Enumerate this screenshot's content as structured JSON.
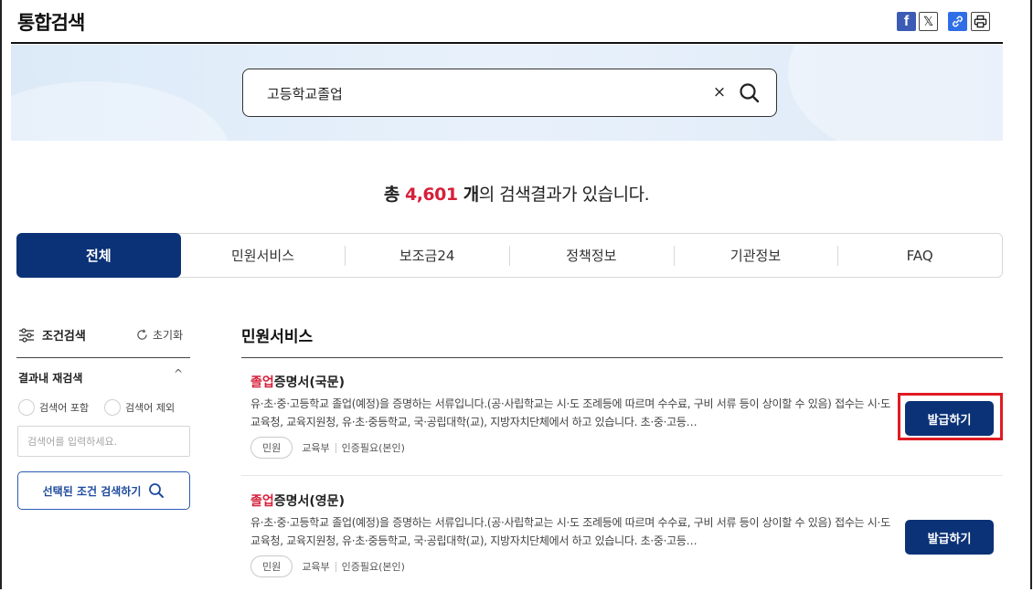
{
  "header": {
    "title": "통합검색",
    "share": {
      "facebook": "f",
      "x": "𝕏"
    }
  },
  "search": {
    "query": "고등학교졸업",
    "clear_icon": "×"
  },
  "summary": {
    "prefix": "총 ",
    "count": "4,601",
    "unit": " 개",
    "suffix": "의 검색결과가 있습니다."
  },
  "tabs": [
    {
      "label": "전체",
      "active": true
    },
    {
      "label": "민원서비스",
      "active": false
    },
    {
      "label": "보조금24",
      "active": false
    },
    {
      "label": "정책정보",
      "active": false
    },
    {
      "label": "기관정보",
      "active": false
    },
    {
      "label": "FAQ",
      "active": false
    }
  ],
  "filter": {
    "title": "조건검색",
    "reset_label": "초기화",
    "refine_title": "결과내 재검색",
    "refine_toggle": "^",
    "include_label": "검색어 포함",
    "exclude_label": "검색어 제외",
    "input_placeholder": "검색어를 입력하세요.",
    "apply_label": "선택된 조건 검색하기"
  },
  "results": {
    "section_title": "민원서비스",
    "items": [
      {
        "title_highlight": "졸업",
        "title_rest": "증명서(국문)",
        "description": "유·초·중·고등학교 졸업(예정)을 증명하는 서류입니다.(공·사립학교는 시·도 조례등에 따르며 수수료, 구비 서류 등이 상이할 수 있음) 접수는 시·도교육청, 교육지원청, 유·초·중등학교, 국·공립대학(교), 지방자치단체에서 하고 있습니다. 초·중·고등…",
        "category": "민원",
        "agency": "교육부",
        "auth": "인증필요(본인)",
        "button": "발급하기"
      },
      {
        "title_highlight": "졸업",
        "title_rest": "증명서(영문)",
        "description": "유·초·중·고등학교 졸업(예정)을 증명하는 서류입니다.(공·사립학교는 시·도 조례등에 따르며 수수료, 구비 서류 등이 상이할 수 있음) 접수는 시·도교육청, 교육지원청, 유·초·중등학교, 국·공립대학(교), 지방자치단체에서 하고 있습니다. 초·중·고등…",
        "category": "민원",
        "agency": "교육부",
        "auth": "인증필요(본인)",
        "button": "발급하기"
      }
    ]
  },
  "colors": {
    "primary": "#0b3276",
    "highlight": "#d6203a",
    "annotation": "#e01b22"
  }
}
